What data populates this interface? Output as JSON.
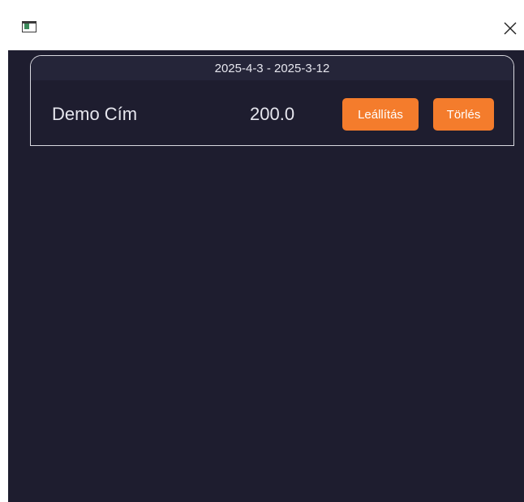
{
  "window": {
    "close_icon": "close-icon",
    "app_icon": "window-app-icon"
  },
  "card": {
    "date_range": "2025-4-3 - 2025-3-12",
    "title": "Demo Cím",
    "amount": "200.0",
    "stop_label": "Leállítás",
    "delete_label": "Törlés"
  },
  "colors": {
    "background": "#1e1d2f",
    "header": "#252539",
    "accent": "#f47c2c",
    "text": "#e6e6ee",
    "border": "#d9d9e0"
  }
}
